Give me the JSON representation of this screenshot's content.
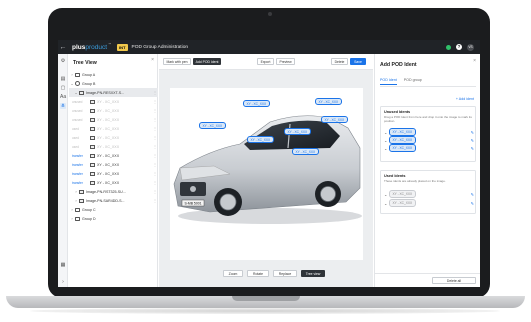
{
  "app": {
    "back_icon": "arrow-left-icon",
    "logo_main": "plus",
    "logo_accent": "product",
    "logo_sub": "™",
    "env_badge": "INT",
    "title": "POD Group Administration",
    "status_color": "#30c06a",
    "help_label": "?",
    "avatar_initials": "VS"
  },
  "tree": {
    "title": "Tree View",
    "rows": [
      {
        "kind": "group",
        "chev": "›",
        "label": "Group A"
      },
      {
        "kind": "group-open",
        "chev": "⌄",
        "label": "Group B"
      },
      {
        "kind": "image",
        "chev": "⌄",
        "label": "Image-PN-RESXXT-S...",
        "selected": true
      },
      {
        "kind": "ident",
        "tag": "unused",
        "label": "XY - XC_XXX",
        "dim": true
      },
      {
        "kind": "ident",
        "tag": "unused",
        "label": "XY - XC_XXX",
        "dim": true
      },
      {
        "kind": "ident",
        "tag": "unused",
        "label": "XY - XC_XXX",
        "dim": true
      },
      {
        "kind": "ident",
        "tag": "used",
        "label": "XY - XC_XXX",
        "dim": true
      },
      {
        "kind": "ident",
        "tag": "used",
        "label": "XY - XC_XXX",
        "dim": true
      },
      {
        "kind": "ident",
        "tag": "used",
        "label": "XY - XC_XXX",
        "dim": true
      },
      {
        "kind": "ident",
        "tag": "transfer",
        "label": "XY - XC_XXX",
        "blue": true
      },
      {
        "kind": "ident",
        "tag": "transfer",
        "label": "XY - XC_XXX",
        "blue": true
      },
      {
        "kind": "ident",
        "tag": "transfer",
        "label": "XY - XC_XXX",
        "blue": true
      },
      {
        "kind": "ident",
        "tag": "transfer",
        "label": "XY - XC_XXX",
        "blue": true
      },
      {
        "kind": "image-closed",
        "chev": "›",
        "label": "Image-PN-RST325-SU..."
      },
      {
        "kind": "image-closed",
        "chev": "›",
        "label": "Image-PN-SAR4DD-S..."
      },
      {
        "kind": "group",
        "chev": "›",
        "label": "Group C"
      },
      {
        "kind": "group",
        "chev": "›",
        "label": "Group D"
      }
    ]
  },
  "toolbar": {
    "mark_label": "Mark with pen",
    "add_label": "Add POD Ident",
    "export_label": "Export",
    "preview_label": "Preview",
    "delete_label": "Delete",
    "save_label": "Save"
  },
  "viewer": {
    "hotspots": [
      "XY - XC_XXX",
      "XY - XC_XXX",
      "XY - XC_XXX",
      "XY - XC_XXX",
      "XY - XC_XXX",
      "XY - XC_XXX",
      "XY - XC_XXX"
    ],
    "plate": "S-MB 5001"
  },
  "bottom_bar": {
    "zoom": "Zoom",
    "rotate": "Rotate",
    "replace": "Replace",
    "tree_view": "Tree view"
  },
  "right_panel": {
    "title": "Add POD Ident",
    "tabs": [
      "POD Ident",
      "POD group"
    ],
    "add_ident": "+ Add ident",
    "unused": {
      "title": "Unused Idents",
      "desc": "Drag a POD Ident from here and drop it onto the image to mark its position.",
      "items": [
        "XY - XC_XXX",
        "XY - XC_XXX",
        "XY - XC_XXX"
      ]
    },
    "used": {
      "title": "Used Idents",
      "desc": "These idents are already placed on the image.",
      "items": [
        "XY - XC_XXX",
        "XY - XC_XXX"
      ]
    },
    "delete_all": "Delete all"
  },
  "colors": {
    "accent": "#1a73e8",
    "topbar": "#202327",
    "badge": "#f2c94c"
  }
}
